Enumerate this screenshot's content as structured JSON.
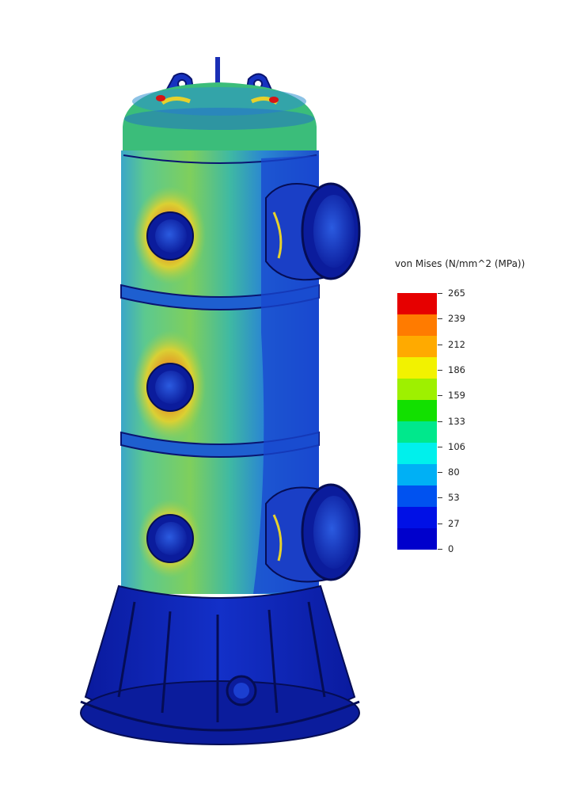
{
  "legend": {
    "title": "von Mises (N/mm^2 (MPa))",
    "ticks": [
      "265",
      "239",
      "212",
      "186",
      "159",
      "133",
      "106",
      "80",
      "53",
      "27",
      "0"
    ],
    "colors": [
      "#e60000",
      "#ff7b00",
      "#ffaa00",
      "#f2f200",
      "#9ef000",
      "#12e000",
      "#00e88c",
      "#00f0ec",
      "#00b0f5",
      "#0052f0",
      "#0010e6",
      "#0000cc"
    ]
  },
  "model": {
    "palette": {
      "deep_blue": "#0a1a9e",
      "blue": "#1433c8",
      "mid_blue": "#1d63d6",
      "cyan": "#1fa8d8",
      "green": "#3cc46a",
      "yellow_green": "#b7d63a",
      "yellow": "#e6d12c",
      "orange": "#f08a1c",
      "red": "#d61414"
    }
  }
}
